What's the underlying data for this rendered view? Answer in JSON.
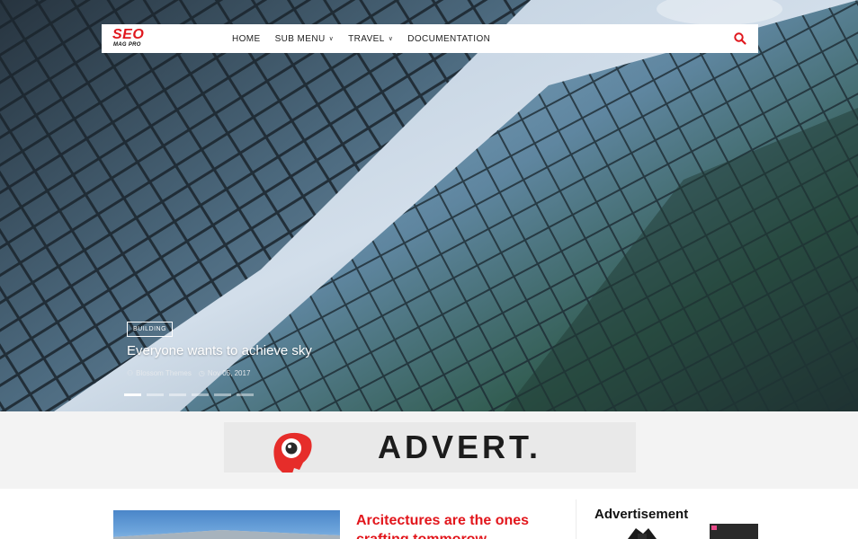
{
  "brand": {
    "logo_main": "SEO",
    "logo_sub": "MAG PRO",
    "accent": "#e0181e"
  },
  "nav": {
    "items": [
      {
        "label": "HOME",
        "has_dropdown": false
      },
      {
        "label": "SUB MENU",
        "has_dropdown": true
      },
      {
        "label": "TRAVEL",
        "has_dropdown": true
      },
      {
        "label": "DOCUMENTATION",
        "has_dropdown": false
      }
    ],
    "search_icon": "search-icon"
  },
  "slider": {
    "category": "BUILDING",
    "title": "Everyone wants to achieve sky",
    "author": "Blossom Themes",
    "date": "Nov 05, 2017",
    "slide_count": 6,
    "active_slide": 1
  },
  "advert": {
    "text": "ADVERT."
  },
  "featured_post": {
    "title": "Arcitectures are the ones crafting tommorow"
  },
  "sidebar": {
    "title": "Advertisement"
  }
}
